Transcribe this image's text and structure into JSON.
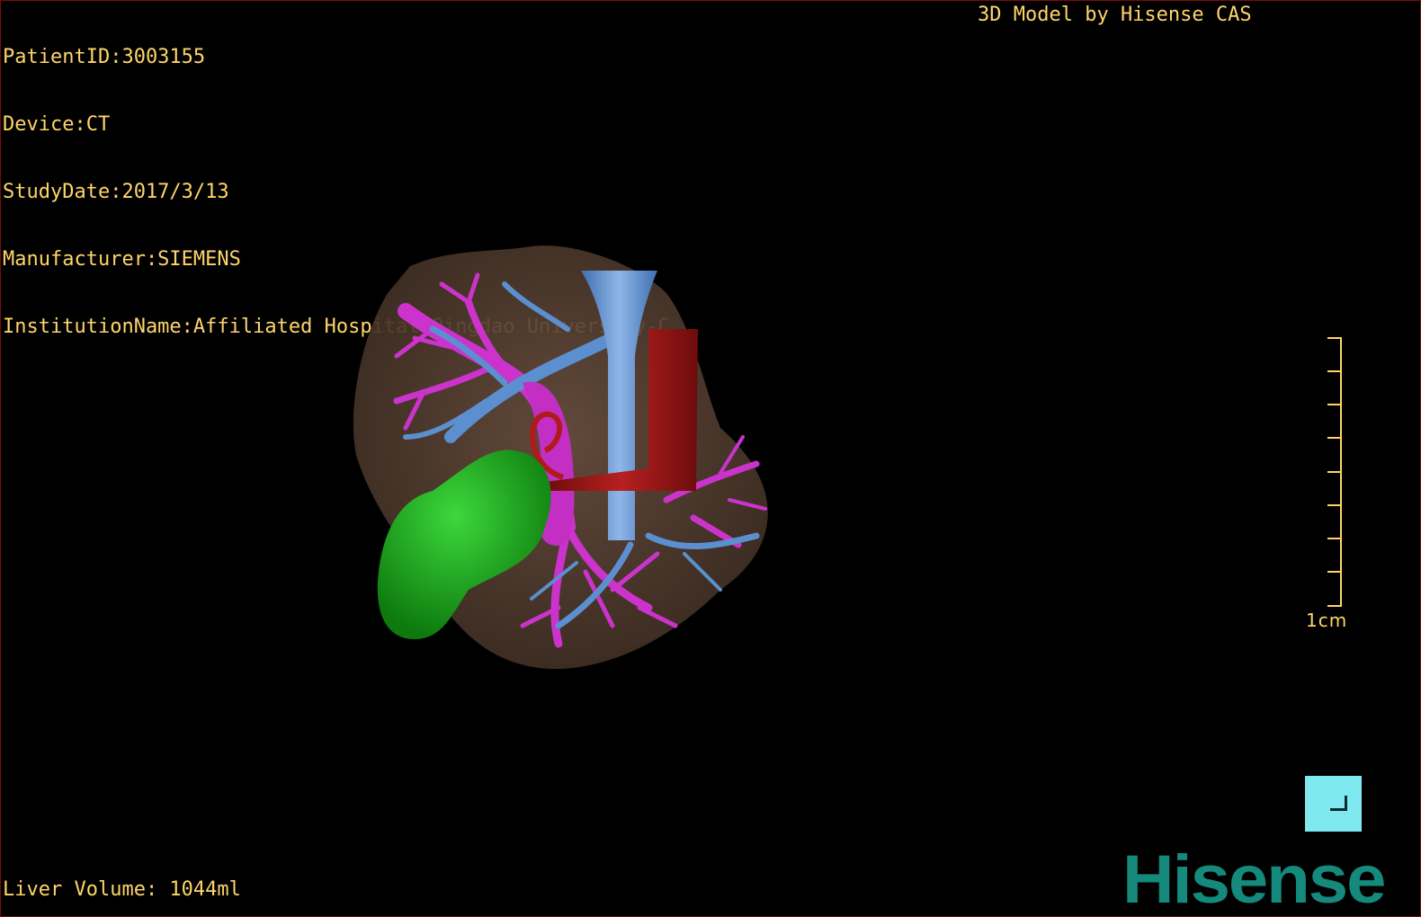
{
  "header": {
    "patient_id": "PatientID:3003155",
    "device": "Device:CT",
    "study_date": "StudyDate:2017/3/13",
    "manufacturer": "Manufacturer:SIEMENS",
    "institution": "InstitutionName:Affiliated Hospital Qingdao University-C"
  },
  "credit": "3D Model by Hisense CAS",
  "footer": {
    "liver_volume": "Liver Volume: 1044ml"
  },
  "scale": {
    "label": "1cm"
  },
  "logo": {
    "text": "Hisense"
  },
  "colors": {
    "overlay_text": "#ffd56a",
    "liver": "#5a4332",
    "portal_vein": "#cc33cc",
    "hepatic_vein": "#5b8fd0",
    "artery": "#a01818",
    "gallbladder": "#1fa51f",
    "logo": "#14897c",
    "corner_button": "#7fe9ef"
  },
  "icons": {
    "corner_button": "reset-view-icon"
  }
}
